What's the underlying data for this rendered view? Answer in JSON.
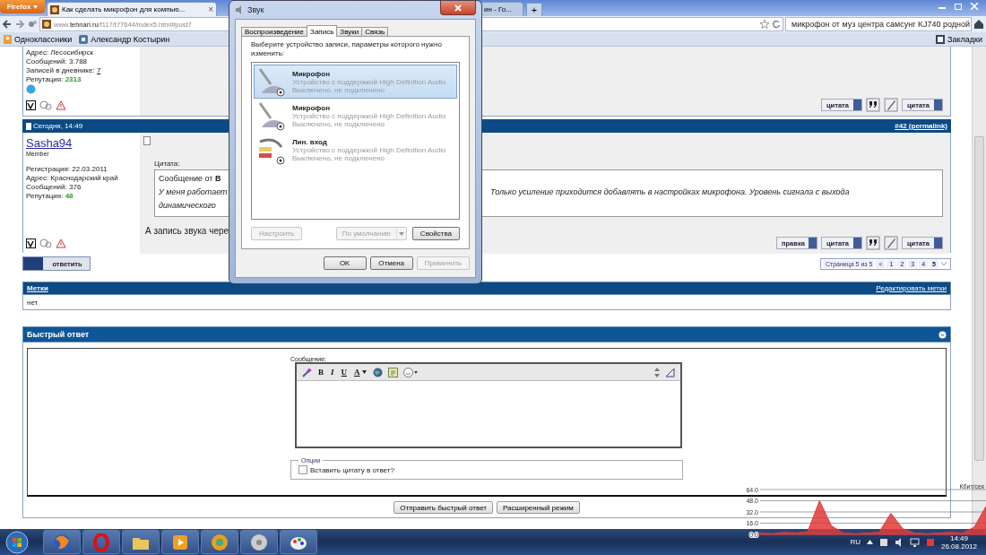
{
  "browser": {
    "menu_button": "Firefox",
    "tabs": [
      {
        "title": "Как сделать микрофон для компью...",
        "selected": true,
        "close": "×"
      },
      {
        "title": "ин - Го...",
        "selected": false
      }
    ],
    "new_tab": "+",
    "address": "www.**tehnari.ru**/f117/t77644/index5.html#post7",
    "search": "микрофон от муз центра самсунг KJ740 родной",
    "bookmarks": [
      {
        "label": "Одноклассники",
        "kind": "ok"
      },
      {
        "label": "Александр Костырин",
        "kind": "vk"
      }
    ],
    "bookmarks_menu": "Закладки"
  },
  "previous_post": {
    "info": [
      {
        "label": "Адрес:",
        "value": "Лесосибирск",
        "kind": "text"
      },
      {
        "label": "Сообщений:",
        "value": "3.788",
        "kind": "text"
      },
      {
        "label": "Записей в дневнике:",
        "value": "7",
        "kind": "link"
      },
      {
        "label": "Репутация:",
        "value": "2313",
        "kind": "reputation"
      }
    ],
    "buttons": [
      {
        "kind": "text",
        "label": "цитата"
      },
      {
        "kind": "quote"
      },
      {
        "kind": "edit"
      },
      {
        "kind": "multi",
        "label": "цитата"
      }
    ]
  },
  "post": {
    "date": "Сегодня, 14:49",
    "link": "#42 (permalink)",
    "user": {
      "name": "Sasha94",
      "rank": "Member",
      "info": [
        {
          "label": "Регистрация:",
          "value": "22.03.2011",
          "kind": "text"
        },
        {
          "label": "Адрес:",
          "value": "Краснодарский край",
          "kind": "text"
        },
        {
          "label": "Сообщений:",
          "value": "376",
          "kind": "text"
        },
        {
          "label": "Репутация:",
          "value": "48",
          "kind": "reputation"
        }
      ]
    },
    "quote_label": "Цитата:",
    "quote_lines": [
      {
        "left": "Сообщение от **В**"
      },
      {
        "left": "У меня работает",
        "right": "Только усиление приходится добавлять в настройках микрофона. Уровень сигнала с выхода"
      },
      {
        "left": "динамического"
      }
    ],
    "text": "А запись звука чере",
    "buttons": [
      {
        "kind": "text",
        "label": "правка"
      },
      {
        "kind": "text",
        "label": "цитата"
      },
      {
        "kind": "quote"
      },
      {
        "kind": "edit"
      },
      {
        "kind": "multi",
        "label": "цитата"
      }
    ]
  },
  "reply_button": "ответить",
  "pagination": {
    "label": "Страница 5 из 5",
    "prev": "<",
    "pages": [
      {
        "label": "1",
        "selected": false
      },
      {
        "label": "2",
        "selected": false
      },
      {
        "label": "3",
        "selected": false
      },
      {
        "label": "4",
        "selected": false
      },
      {
        "label": "5",
        "selected": true
      }
    ]
  },
  "tags": {
    "title": "Метки",
    "edit": "Редактировать метки",
    "value": "нет"
  },
  "quick_reply": {
    "title": "Быстрый ответ",
    "message_label": "Сообщение:",
    "toolbar": [
      {
        "kind": "wand"
      },
      {
        "kind": "bold",
        "label": "B"
      },
      {
        "kind": "italic",
        "label": "I"
      },
      {
        "kind": "underline",
        "label": "U"
      },
      {
        "kind": "color",
        "label": "A"
      },
      {
        "kind": "link"
      },
      {
        "kind": "note"
      },
      {
        "kind": "smiley"
      }
    ],
    "options_legend": "Опции",
    "checkbox": {
      "label": "Вставить цитату в ответ?",
      "checked": false
    },
    "buttons": [
      "Отправить быстрый ответ",
      "Расширенный режим"
    ]
  },
  "dialog": {
    "title": "Звук",
    "tabs": [
      {
        "label": "Воспроизведение",
        "selected": false
      },
      {
        "label": "Запись",
        "selected": true
      },
      {
        "label": "Звуки",
        "selected": false
      },
      {
        "label": "Связь",
        "selected": false
      }
    ],
    "instruction": "Выберите устройство записи, параметры которого нужно изменить:",
    "devices": [
      {
        "kind": "mic",
        "name": "Микрофон",
        "description": "Устройство с поддержкой High Definition Audio",
        "status": "Выключено, не подключено",
        "selected": true
      },
      {
        "kind": "mic",
        "name": "Микрофон",
        "description": "Устройство с поддержкой High Definition Audio",
        "status": "Выключено, не подключено",
        "selected": false
      },
      {
        "kind": "line",
        "name": "Лин. вход",
        "description": "Устройство с поддержкой High Definition Audio",
        "status": "Выключено, не подключено",
        "selected": false
      }
    ],
    "configure": {
      "label": "Настроить",
      "disabled": true
    },
    "default": {
      "label": "По умолчанию",
      "disabled": true
    },
    "properties": {
      "label": "Свойства",
      "disabled": false
    },
    "footer": [
      {
        "label": "OK",
        "disabled": false
      },
      {
        "label": "Отмена",
        "disabled": false
      },
      {
        "label": "Применить",
        "disabled": true
      }
    ]
  },
  "taskbar": {
    "apps": [
      {
        "kind": "globe"
      },
      {
        "kind": "ring"
      },
      {
        "kind": "folder"
      },
      {
        "kind": "play"
      },
      {
        "kind": "ball"
      },
      {
        "kind": "disc"
      },
      {
        "kind": "palette"
      }
    ],
    "language": "RU",
    "time": "14:49",
    "date": "26.08.2012"
  },
  "network_meter": {
    "chart_data": {
      "type": "area",
      "grid": true,
      "ylabel": "Кбит/сек",
      "ylim": [
        0,
        64
      ],
      "yticks": [
        {
          "value": 64,
          "label": "64.0"
        },
        {
          "value": 48,
          "label": "48.0"
        },
        {
          "value": 32,
          "label": "32.0"
        },
        {
          "value": 16,
          "label": "16.0"
        },
        {
          "value": 0,
          "label": "0.0"
        }
      ],
      "series": [
        {
          "color": "#e03a3a",
          "values": [
            2,
            1,
            3,
            2,
            4,
            48,
            12,
            2,
            1,
            2,
            3,
            30,
            8,
            2,
            1,
            2,
            3,
            2,
            10,
            40
          ]
        }
      ]
    }
  }
}
